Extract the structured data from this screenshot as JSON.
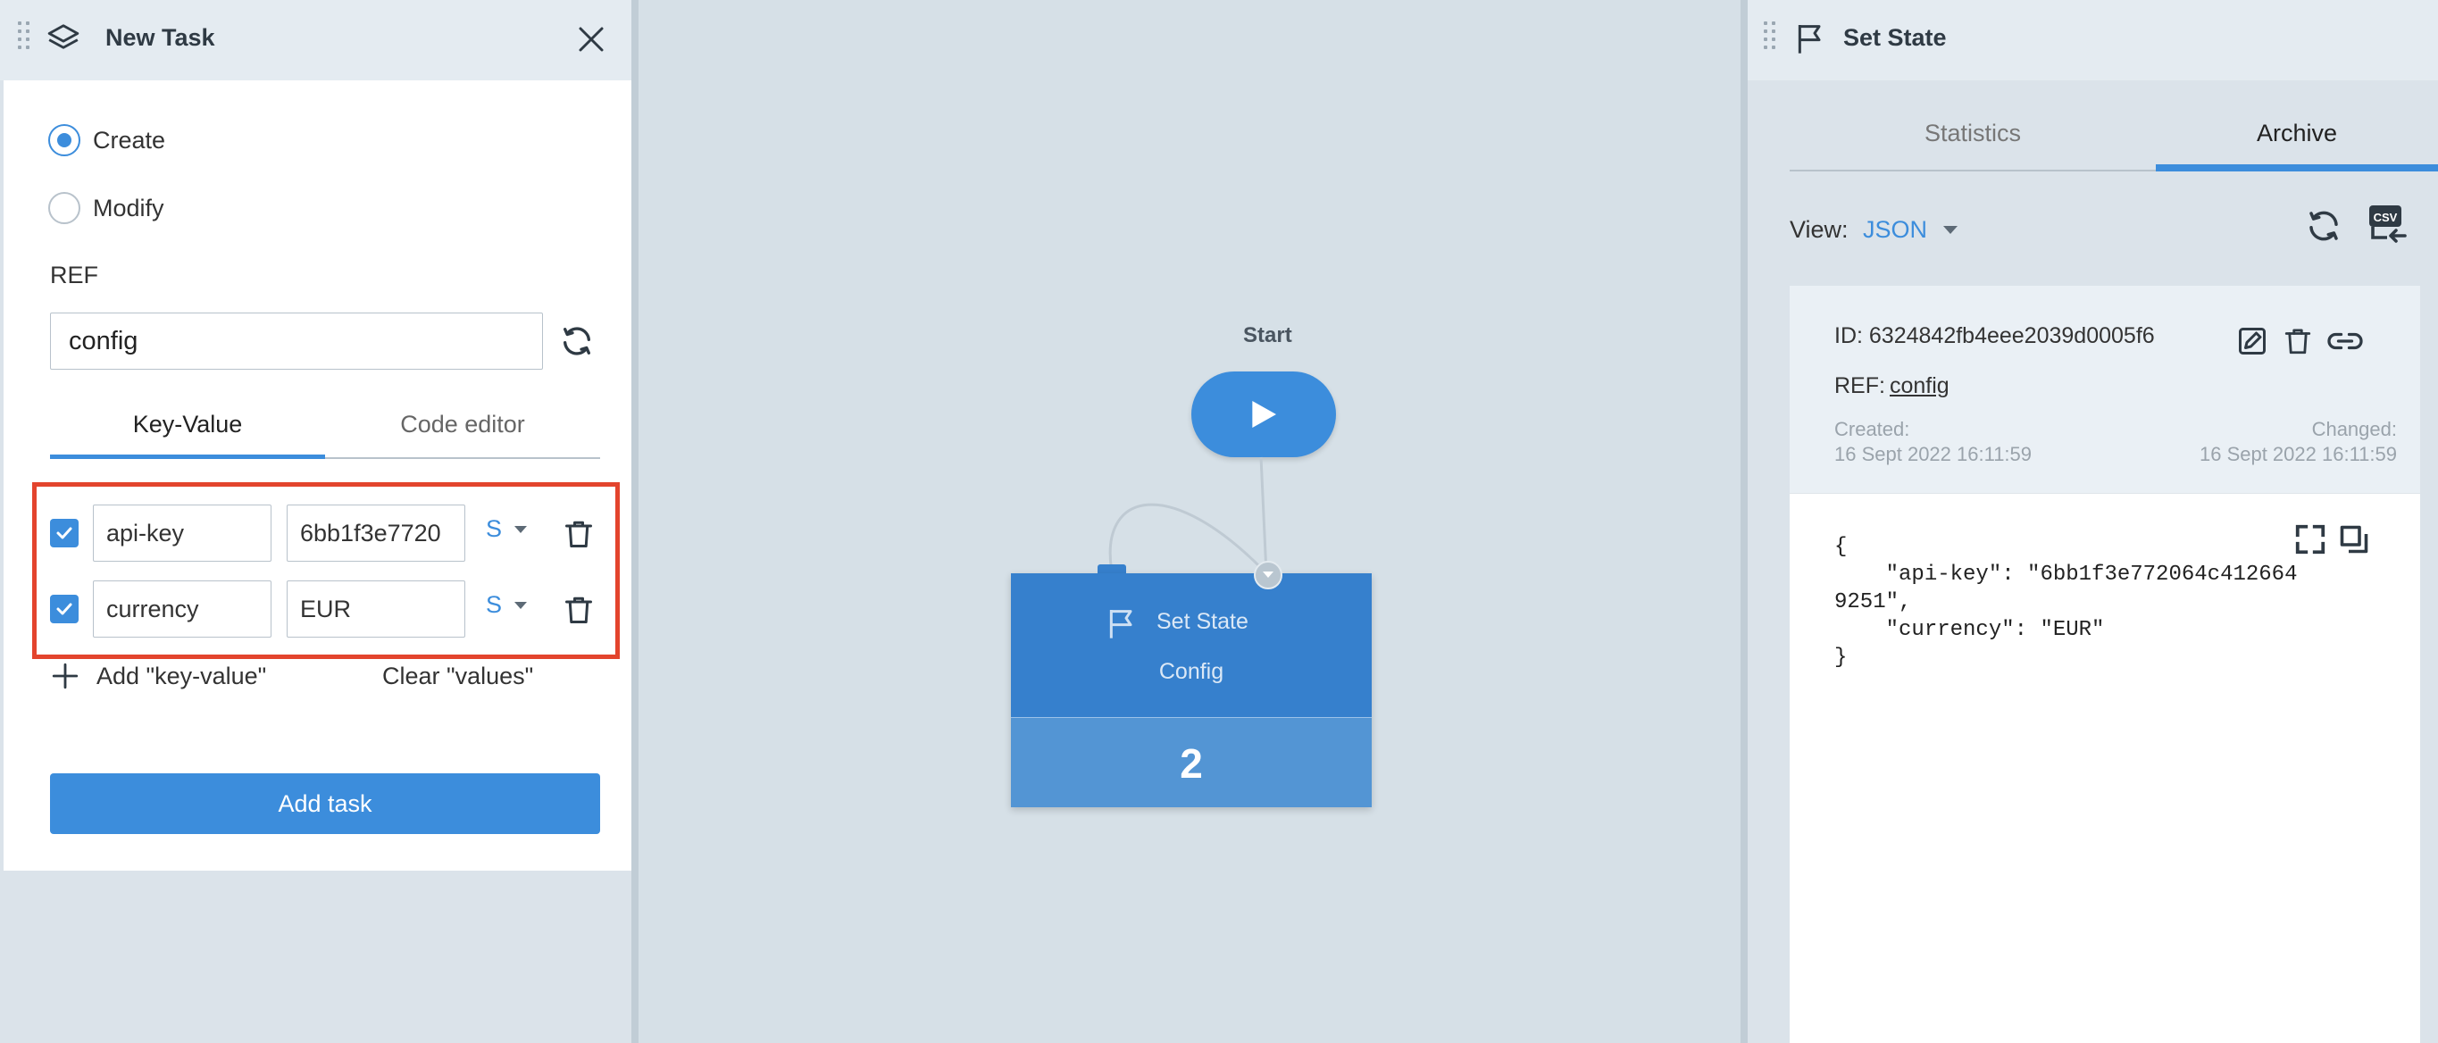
{
  "left_panel": {
    "title": "New Task",
    "mode_options": [
      "Create",
      "Modify"
    ],
    "selected_mode": "Create",
    "ref_label": "REF",
    "ref_value": "config",
    "tabs": [
      "Key-Value",
      "Code editor"
    ],
    "active_tab": "Key-Value",
    "rows": [
      {
        "checked": true,
        "key": "api-key",
        "value": "6bb1f3e7720",
        "type": "S"
      },
      {
        "checked": true,
        "key": "currency",
        "value": "EUR",
        "type": "S"
      }
    ],
    "add_kv_label": "Add \"key-value\"",
    "clear_values_label": "Clear \"values\"",
    "add_task_label": "Add task"
  },
  "canvas": {
    "start_label": "Start",
    "node": {
      "type": "Set State",
      "name": "Config",
      "count": "2"
    }
  },
  "right_panel": {
    "title": "Set State",
    "tabs": [
      "Statistics",
      "Archive"
    ],
    "active_tab": "Archive",
    "view_label": "View:",
    "view_value": "JSON",
    "card": {
      "id_text": "ID: 6324842fb4eee2039d0005f6",
      "ref_label": "REF:",
      "ref_value": "config",
      "created_label": "Created:",
      "created_value": "16 Sept 2022 16:11:59",
      "changed_label": "Changed:",
      "changed_value": "16 Sept 2022 16:11:59"
    },
    "json_text": "{\n    \"api-key\": \"6bb1f3e772064c412664\n9251\",\n    \"currency\": \"EUR\"\n}"
  },
  "colors": {
    "accent": "#3c8ddc",
    "node": "#3680cd",
    "highlight": "#e3442d",
    "background": "#d6e0e7"
  },
  "icons": [
    "layers-icon",
    "close-icon",
    "refresh-icon",
    "trash-icon",
    "plus-icon",
    "play-icon",
    "flag-icon",
    "csv-export-icon",
    "edit-icon",
    "link-icon",
    "expand-icon",
    "copy-icon"
  ]
}
